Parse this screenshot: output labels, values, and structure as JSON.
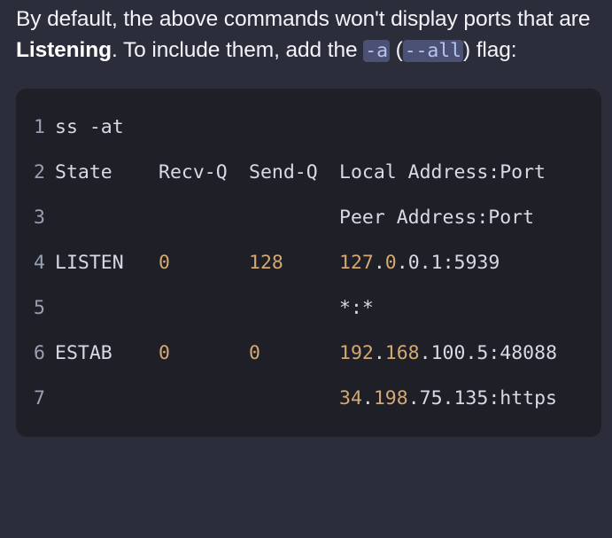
{
  "paragraph": {
    "part1": "By default, the above commands won't display ports that are ",
    "bold": "Listening",
    "part2": ". To include them, add the ",
    "code1": "-a",
    "part3": " (",
    "code2": "--all",
    "part4": ") flag:"
  },
  "code": {
    "line_numbers": [
      "1",
      "2",
      "3",
      "4",
      "5",
      "6",
      "7"
    ],
    "command": "ss -at",
    "header": {
      "state": "State",
      "recv": "Recv-Q",
      "send": "Send-Q",
      "local": "Local Address:Port",
      "peer": "Peer Address:Port"
    },
    "rows": [
      {
        "state": "LISTEN",
        "recv": "0",
        "send": "128",
        "local": {
          "a": "127",
          "b": "0",
          "c": "0",
          "d": "1",
          "port": "5939"
        },
        "peer": "*:*"
      },
      {
        "state": "ESTAB",
        "recv": "0",
        "send": "0",
        "local": {
          "a": "192",
          "b": "168",
          "c": "100",
          "d": "5",
          "port": "48088"
        },
        "peer": {
          "a": "34",
          "b": "198",
          "c": "75",
          "d": "135",
          "port": "https"
        }
      }
    ]
  },
  "colors": {
    "background": "#2b2d3b",
    "code_background": "#1e1f27",
    "inline_code_background": "#4a5174",
    "inline_code_text": "#b7c3f0",
    "number": "#d5a873",
    "text": "#d7dae6",
    "line_number": "#9aa0b4"
  }
}
